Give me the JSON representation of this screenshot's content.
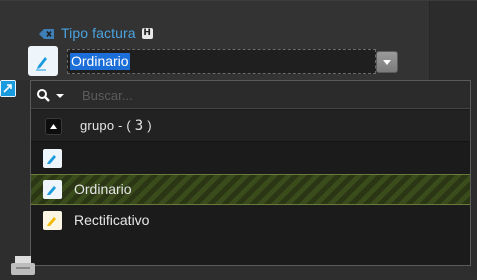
{
  "field": {
    "label": "Tipo factura",
    "help_badge": "H",
    "selected_value": "Ordinario"
  },
  "dropdown": {
    "search_placeholder": "Buscar...",
    "group": {
      "label": "grupo",
      "separator": " - ( ",
      "count": "3",
      "close": " )"
    },
    "options": [
      {
        "label": "",
        "icon_color": "#1a9be0"
      },
      {
        "label": "Ordinario",
        "icon_color": "#1a9be0",
        "highlighted": true
      },
      {
        "label": "Rectificativo",
        "icon_color": "#f0b800"
      }
    ]
  },
  "colors": {
    "accent": "#4aa3df",
    "selection": "#1c6ed8",
    "highlight": "#3a4c1c"
  }
}
